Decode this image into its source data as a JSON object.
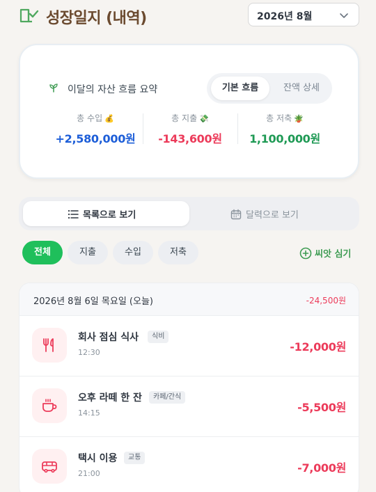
{
  "header": {
    "title": "성장일지 (내역)",
    "month_value": "2026년 8월"
  },
  "summary": {
    "title": "이달의 자산 흐름 요약",
    "segments": [
      "기본 흐름",
      "잔액 상세"
    ],
    "stats": [
      {
        "label": "총 수입",
        "emoji": "💰",
        "value": "+2,580,000원",
        "color": "#1d5ed8"
      },
      {
        "label": "총 지출",
        "emoji": "💸",
        "value": "-143,600원",
        "color": "#ec3b5a"
      },
      {
        "label": "총 저축",
        "emoji": "🪴",
        "value": "1,100,000원",
        "color": "#1f9a55"
      }
    ]
  },
  "view_toggle": {
    "list_label": "목록으로 보기",
    "calendar_label": "달력으로 보기"
  },
  "filters": {
    "chips": [
      "전체",
      "지출",
      "수입",
      "저축"
    ],
    "plant_label": "씨앗 심기"
  },
  "day_group": {
    "date": "2026년 8월 6일 목요일 (오늘)",
    "total": "-24,500원",
    "transactions": [
      {
        "name": "회사 점심 식사",
        "tag": "식비",
        "time": "12:30",
        "amount": "-12,000원",
        "icon": "utensils-icon"
      },
      {
        "name": "오후 라떼 한 잔",
        "tag": "카페/간식",
        "time": "14:15",
        "amount": "-5,500원",
        "icon": "coffee-cup-icon"
      },
      {
        "name": "택시 이용",
        "tag": "교통",
        "time": "21:00",
        "amount": "-7,000원",
        "icon": "bus-icon"
      }
    ]
  }
}
